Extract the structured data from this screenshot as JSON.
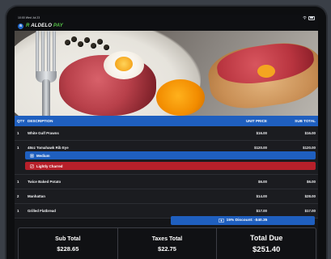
{
  "status": {
    "time": "10:00 Wed Jul 23",
    "wifi": "wifi-icon",
    "battery": "battery-icon"
  },
  "app": {
    "brand_prefix": "ALDELO ",
    "brand_pay": "PAY"
  },
  "table": {
    "headers": {
      "qty": "QTY",
      "description": "DESCRIPTION",
      "unit_price": "UNIT PRICE",
      "sub_total": "SUB TOTAL"
    },
    "rows": [
      {
        "qty": "1",
        "description": "White Gulf Prawns",
        "unit_price": "$16.00",
        "sub_total": "$16.00"
      },
      {
        "qty": "1",
        "description": "48oz Tomahawk Rib Eye",
        "unit_price": "$120.00",
        "sub_total": "$120.00",
        "modifiers": [
          {
            "label": "Medium",
            "color": "#1f5fbf"
          },
          {
            "label": "Lightly Charred",
            "color": "#b7202a"
          }
        ]
      },
      {
        "qty": "1",
        "description": "Twice Baked Potato",
        "unit_price": "$6.00",
        "sub_total": "$6.00"
      },
      {
        "qty": "2",
        "description": "Manhattan",
        "unit_price": "$14.00",
        "sub_total": "$28.00"
      },
      {
        "qty": "1",
        "description": "Grilled Flatbread",
        "unit_price": "$17.00",
        "sub_total": "$17.00"
      }
    ]
  },
  "discount": {
    "label": "15% Discount: -$40.35"
  },
  "totals": {
    "subtotal_label": "Sub Total",
    "subtotal_value": "$228.65",
    "taxes_label": "Taxes Total",
    "taxes_value": "$22.75",
    "due_label": "Total Due",
    "due_value": "$251.40"
  },
  "colors": {
    "accent": "#1f5fbf",
    "modifier_red": "#b7202a",
    "brand_green": "#55c247"
  }
}
